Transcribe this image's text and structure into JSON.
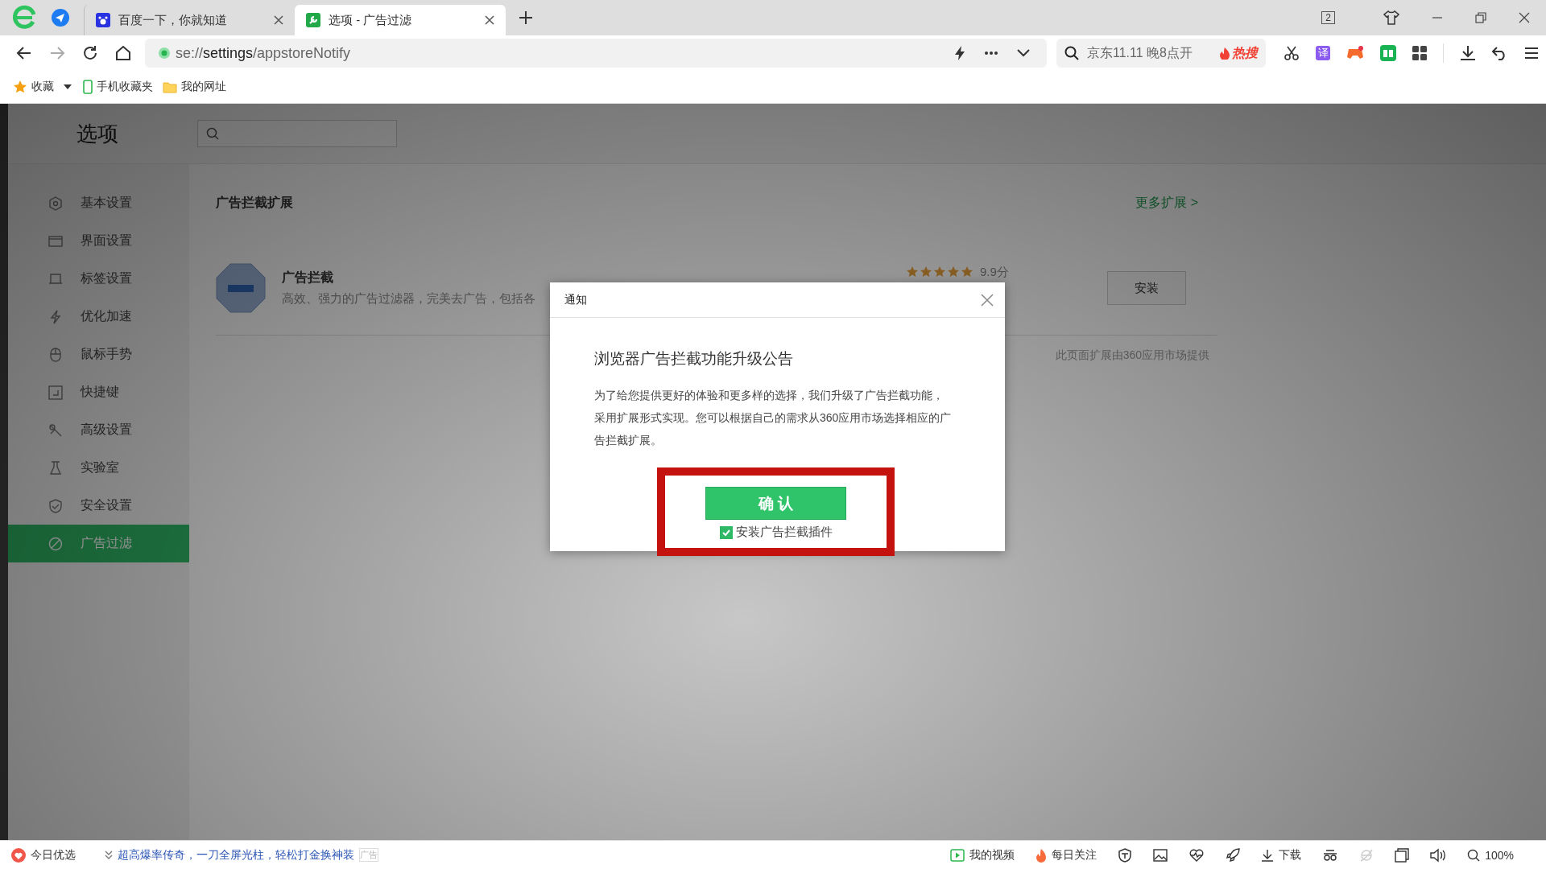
{
  "browser": {
    "tabs": [
      {
        "label": "百度一下，你就知道",
        "selected": false
      },
      {
        "label": "选项 - 广告过滤",
        "selected": true
      }
    ],
    "tab_count": "2",
    "address": "se://**settings**/appstoreNotify",
    "search": {
      "value": "京东11.11 晚8点开",
      "hot_label": "热搜"
    },
    "translate_label": "译",
    "bookmarks": [
      {
        "label": "收藏"
      },
      {
        "label": "手机收藏夹"
      },
      {
        "label": "我的网址"
      }
    ]
  },
  "page": {
    "title": "选项",
    "sidebar": {
      "items": [
        {
          "label": "基本设置",
          "selected": false
        },
        {
          "label": "界面设置",
          "selected": false
        },
        {
          "label": "标签设置",
          "selected": false
        },
        {
          "label": "优化加速",
          "selected": false
        },
        {
          "label": "鼠标手势",
          "selected": false
        },
        {
          "label": "快捷键",
          "selected": false
        },
        {
          "label": "高级设置",
          "selected": false
        },
        {
          "label": "实验室",
          "selected": false
        },
        {
          "label": "安全设置",
          "selected": false
        },
        {
          "label": "广告过滤",
          "selected": true
        }
      ]
    },
    "section_title": "广告拦截扩展",
    "more_link": "更多扩展 >",
    "extension": {
      "name": "广告拦截",
      "description": "高效、强力的广告过滤器，完美去广告，包括各",
      "stars": 5,
      "score": "9.9分",
      "install_button": "安装"
    },
    "footer_note": "此页面扩展由360应用市场提供"
  },
  "dialog": {
    "title": "通知",
    "heading": "浏览器广告拦截功能升级公告",
    "body": "为了给您提供更好的体验和更多样的选择，我们升级了广告拦截功能，采用扩展形式实现。您可以根据自己的需求从360应用市场选择相应的广告拦截扩展。",
    "confirm_button": "确 认",
    "checkbox": {
      "label": "安装广告拦截插件",
      "checked": true
    }
  },
  "status_bar": {
    "left": [
      {
        "label": "今日优选"
      }
    ],
    "ad_text": "超高爆率传奇，一刀全屏光柱，轻松打金换神装",
    "ad_tag": "广告",
    "video": "我的视频",
    "follow": "每日关注",
    "download": "下载",
    "zoom": "100%"
  }
}
